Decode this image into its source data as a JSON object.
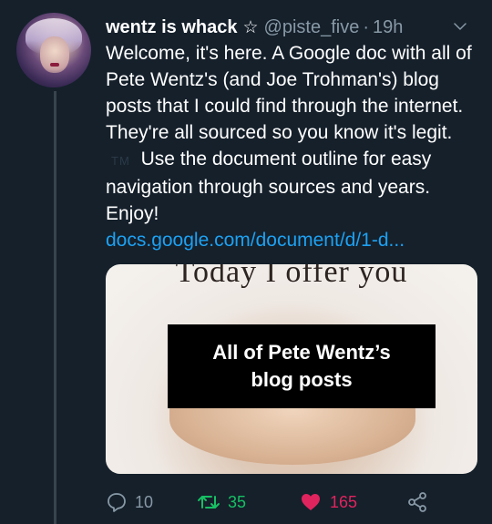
{
  "tweet": {
    "display_name": "wentz is whack",
    "name_emoji": "☆",
    "handle": "@piste_five",
    "separator": "·",
    "time": "19h",
    "text_main": "Welcome, it's here. A Google doc with all of Pete Wentz's (and Joe Trohman's) blog posts that I could find through the internet. They're all sourced so you know it's legit.",
    "text_tm": "TM",
    "text_after": "Use the document outline for easy navigation through sources and years. Enjoy!",
    "link": "docs.google.com/document/d/1-d..."
  },
  "media": {
    "top_text": "Today I offer you",
    "banner_line1": "All of Pete Wentz’s",
    "banner_line2": "blog posts"
  },
  "actions": {
    "reply_count": "10",
    "retweet_count": "35",
    "like_count": "165"
  },
  "colors": {
    "background": "#15202b",
    "link": "#1da1f2",
    "retweet": "#17bf63",
    "like": "#e0245e",
    "muted": "#8899a6"
  }
}
